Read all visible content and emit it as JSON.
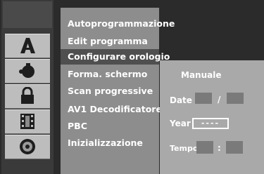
{
  "menu": {
    "items": [
      {
        "label": "Autoprogrammazione",
        "selected": false
      },
      {
        "label": "Edit programma",
        "selected": false
      },
      {
        "label": "Configurare orologio",
        "selected": true
      },
      {
        "label": "Forma. schermo",
        "selected": false
      },
      {
        "label": "Scan progressive",
        "selected": false
      },
      {
        "label": "AV1 Decodificatore",
        "selected": false
      },
      {
        "label": "PBC",
        "selected": false
      },
      {
        "label": "Inizializzazione",
        "selected": false
      }
    ]
  },
  "clock": {
    "mode": "Manuale",
    "date_label": "Date",
    "date_separator": "/",
    "year_label": "Year",
    "year_value": "----",
    "time_label": "Tempo",
    "time_separator": ":"
  },
  "icons": [
    "language-icon",
    "display-icon",
    "lock-icon",
    "film-icon",
    "disc-icon"
  ],
  "colors": {
    "background": "#2b2b2b",
    "menu_panel": "#8d8d8d",
    "selected_item": "#4f4f4f",
    "settings_panel": "#a9a9a9"
  }
}
